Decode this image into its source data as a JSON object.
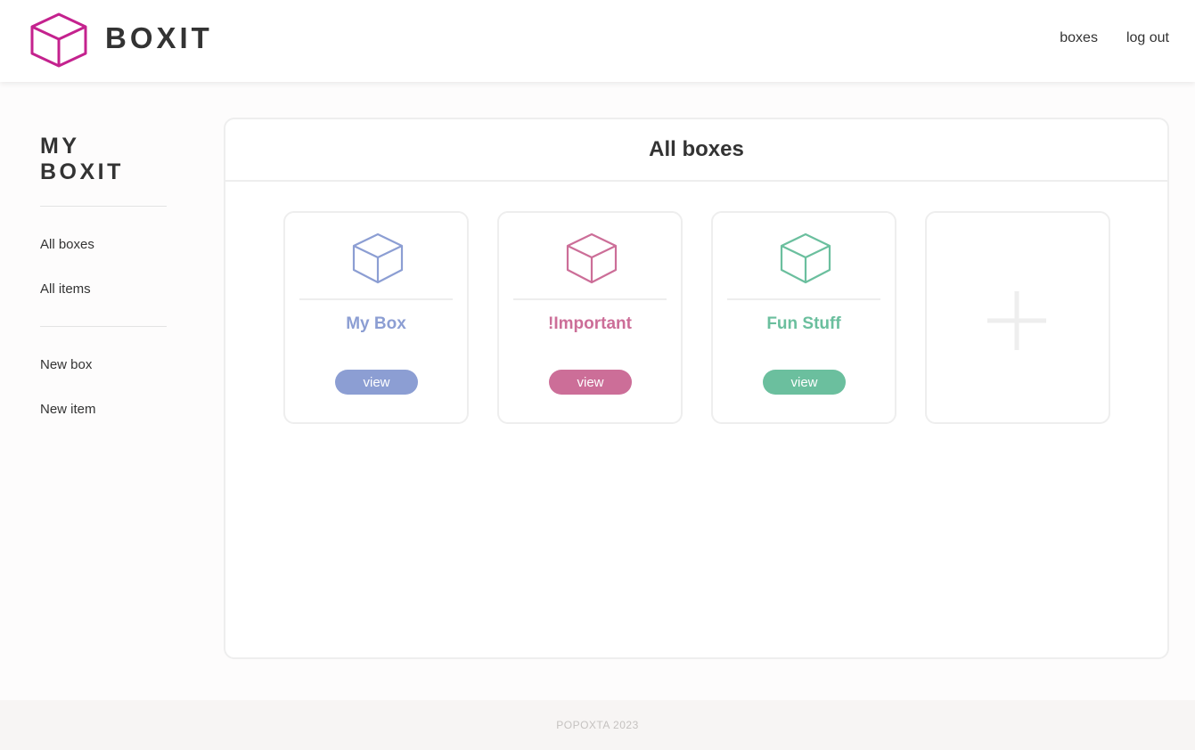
{
  "app": {
    "name": "BOXIT",
    "logo_color": "#c4228e"
  },
  "top_nav": {
    "boxes_label": "boxes",
    "logout_label": "log out"
  },
  "sidebar": {
    "title": "MY BOXIT",
    "links": [
      {
        "label": "All boxes"
      },
      {
        "label": "All items"
      },
      {
        "label": "New box"
      },
      {
        "label": "New item"
      }
    ]
  },
  "main": {
    "title": "All boxes",
    "boxes": [
      {
        "name": "My Box",
        "button_label": "view",
        "color": "#8c9ed3",
        "icon": "box-icon"
      },
      {
        "name": "!Important",
        "button_label": "view",
        "color": "#cc6e98",
        "icon": "box-icon"
      },
      {
        "name": "Fun Stuff",
        "button_label": "view",
        "color": "#6bbf9e",
        "icon": "box-icon"
      }
    ],
    "add_box": {
      "icon": "plus-icon",
      "color": "#eeeeee"
    }
  },
  "footer": {
    "text": "POPOXTA 2023"
  }
}
